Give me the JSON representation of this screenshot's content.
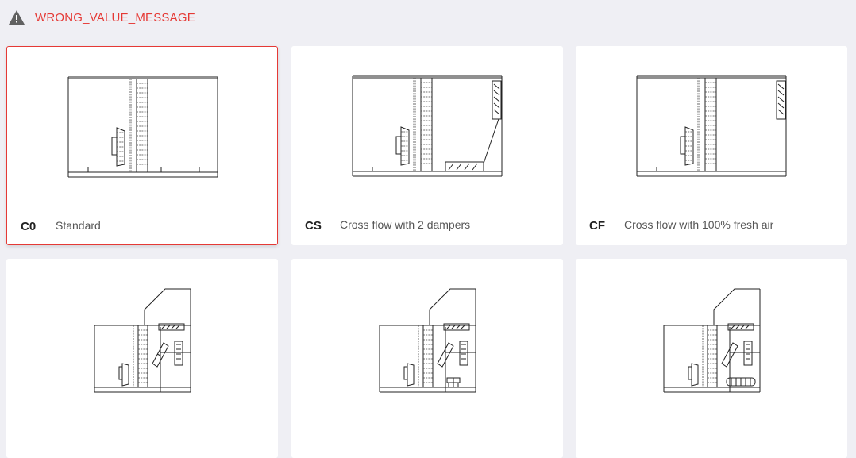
{
  "warning": {
    "icon": "warning-icon",
    "message": "WRONG_VALUE_MESSAGE",
    "color": "#e53935"
  },
  "options": [
    {
      "code": "C0",
      "name": "Standard",
      "selected": true,
      "icon": "standard-layout-diagram"
    },
    {
      "code": "CS",
      "name": "Cross flow with 2 dampers",
      "selected": false,
      "icon": "cross-flow-2-dampers-diagram"
    },
    {
      "code": "CF",
      "name": "Cross flow with 100% fresh air",
      "selected": false,
      "icon": "cross-flow-fresh-air-diagram"
    },
    {
      "code": "",
      "name": "",
      "selected": false,
      "icon": "roof-layout-diagram"
    },
    {
      "code": "",
      "name": "",
      "selected": false,
      "icon": "roof-layout-damper-diagram"
    },
    {
      "code": "",
      "name": "",
      "selected": false,
      "icon": "roof-layout-heater-diagram"
    }
  ],
  "colors": {
    "background": "#efeff4",
    "card": "#ffffff",
    "selected_border": "#e53935"
  }
}
